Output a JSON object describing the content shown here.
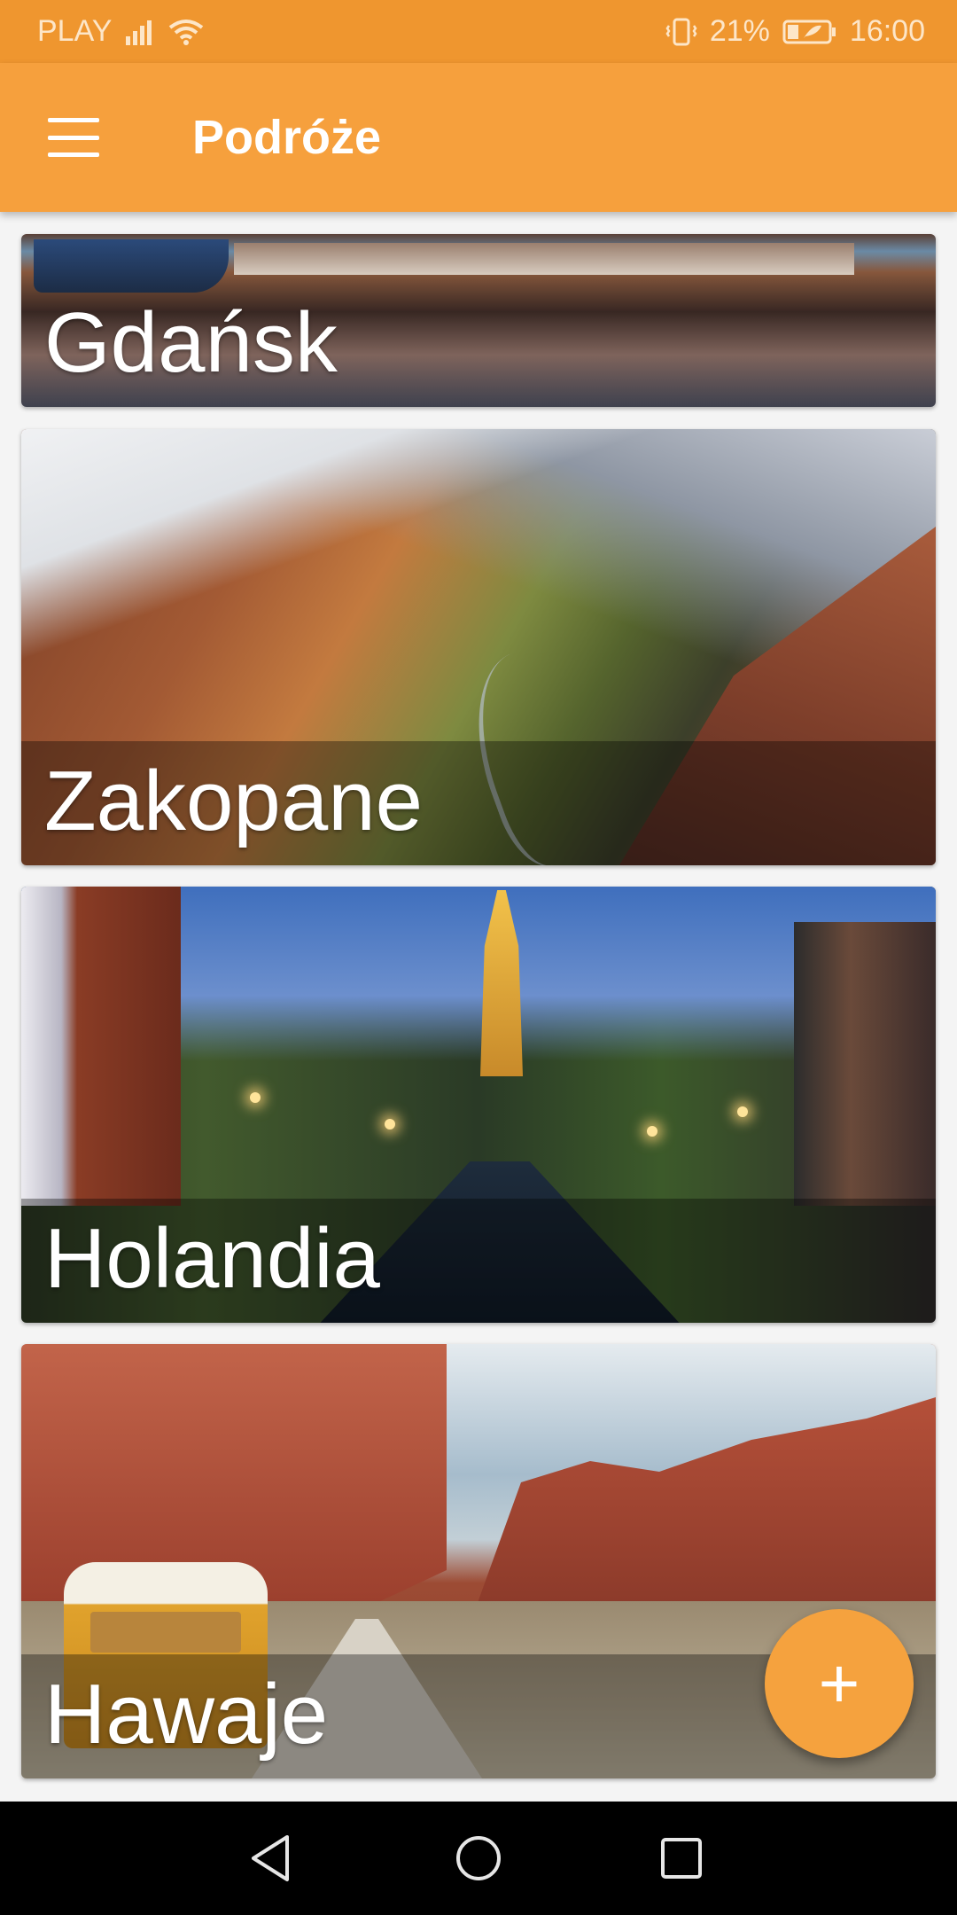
{
  "status_bar": {
    "carrier": "PLAY",
    "battery": "21%",
    "time": "16:00",
    "icons": [
      "signal-icon",
      "wifi-icon",
      "vibrate-icon",
      "battery-icon"
    ]
  },
  "app_bar": {
    "title": "Podróże",
    "menu_icon": "hamburger-menu-icon"
  },
  "places": [
    {
      "name": "Gdańsk"
    },
    {
      "name": "Zakopane"
    },
    {
      "name": "Holandia"
    },
    {
      "name": "Hawaje"
    }
  ],
  "fab": {
    "symbol": "+",
    "icon": "add-icon"
  },
  "nav_bar": {
    "icons": [
      "back-icon",
      "home-icon",
      "recents-icon"
    ]
  },
  "colors": {
    "status_bar": "#ef962f",
    "app_bar": "#f6a03d",
    "fab": "#f5a23e",
    "background": "#f4f4f4"
  }
}
